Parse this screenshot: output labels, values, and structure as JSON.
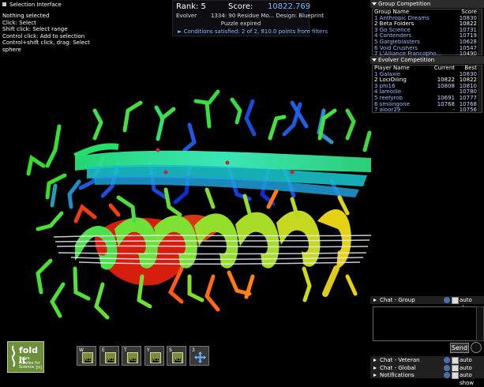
{
  "selection": {
    "title": "Selection Interface",
    "lines": [
      "Nothing selected",
      "Click: Select",
      "Shift click: Select range",
      "Control click: Add to selection",
      "Control+shift click, drag: Select sphere"
    ]
  },
  "header": {
    "rank_label": "Rank: 5",
    "score_label": "Score:",
    "score_value": "10822.769",
    "evolver": "Evolver",
    "puzzle": "1334: 90 Residue Mo... Design: Blueprint",
    "expired": "Puzzle expired",
    "conditions": "Conditions satisfied: 2 of 2, 810.0 points from filters"
  },
  "group_competition": {
    "title": "Group Competition",
    "columns": [
      "Group Name",
      "Score"
    ],
    "rows": [
      {
        "name": "1 Anthropic Dreams",
        "score": "10830"
      },
      {
        "name": "2 Beta Folders",
        "score": "10822"
      },
      {
        "name": "3 Go Science",
        "score": "10731"
      },
      {
        "name": "4 Contenders",
        "score": "10719"
      },
      {
        "name": "5 Gargleblasters",
        "score": "10628"
      },
      {
        "name": "6 Void Crushers",
        "score": "10547"
      },
      {
        "name": "7 L'Alliance Francopho...",
        "score": "10490"
      }
    ]
  },
  "evolver_competition": {
    "title": "Evolver Competition",
    "columns": [
      "Player Name",
      "Current",
      "Best"
    ],
    "rows": [
      {
        "name": "1 Galaxie",
        "current": "",
        "best": "10830"
      },
      {
        "name": "2 LociOiling",
        "current": "10822",
        "best": "10822"
      },
      {
        "name": "3 phi16",
        "current": "10808",
        "best": "10810"
      },
      {
        "name": "4 lamoille",
        "current": "",
        "best": "10780"
      },
      {
        "name": "5 reefyrob",
        "current": "10691",
        "best": "10777"
      },
      {
        "name": "6 smilingone",
        "current": "10768",
        "best": "10768"
      },
      {
        "name": "7 aloor29",
        "current": "-",
        "best": "10756"
      }
    ]
  },
  "chat": {
    "group_label": "Chat - Group",
    "veteran_label": "Chat - Veteran",
    "global_label": "Chat - Global",
    "notifications_label": "Notifications",
    "auto_show": "auto show",
    "send_label": "Send"
  },
  "logo": {
    "word": "fold it",
    "tagline": "Solve Puzzles for Science",
    "level": "[H]"
  },
  "toolbar": [
    {
      "key": "W",
      "name": "wiggle-tool",
      "all": "ALL"
    },
    {
      "key": "E",
      "name": "wiggle-sidechains-tool",
      "all": "ALL"
    },
    {
      "key": "T",
      "name": "tweak-tool",
      "all": "ALL"
    },
    {
      "key": "Y",
      "name": "rebuild-tool",
      "all": "ALL"
    },
    {
      "key": "S",
      "name": "shake-tool",
      "all": "ALL"
    },
    {
      "key": "3",
      "name": "move-tool",
      "all": ""
    }
  ],
  "colors": {
    "accent": "#7fb6ff",
    "panel_header": "#2c2c2c",
    "background": "#000000"
  }
}
